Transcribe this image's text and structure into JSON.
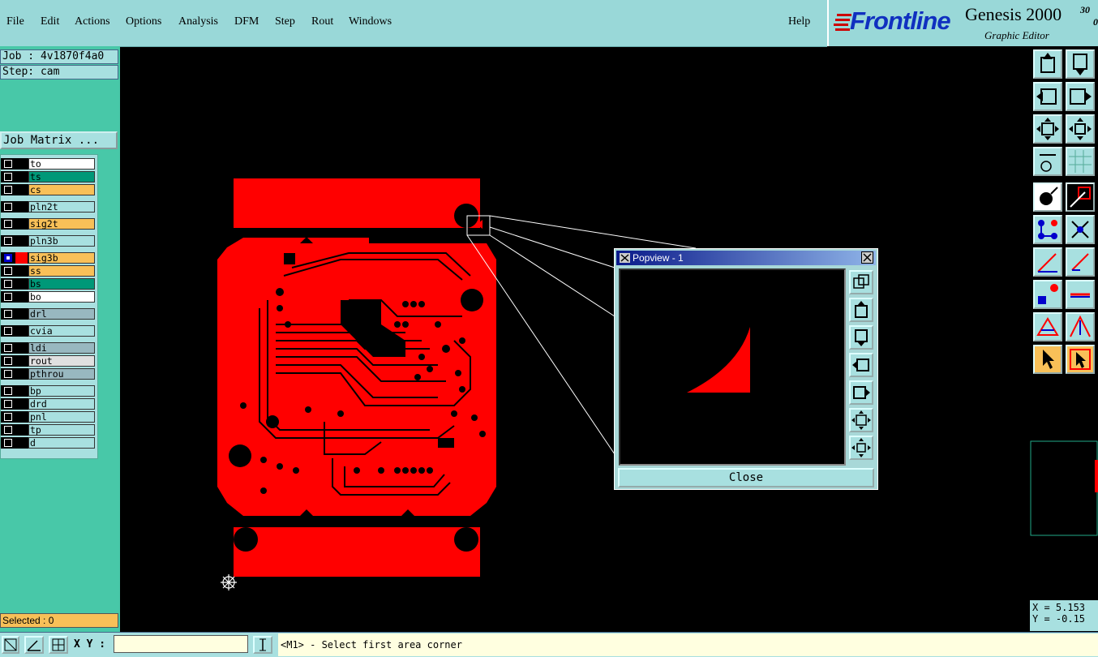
{
  "menu": {
    "items": [
      "File",
      "Edit",
      "Actions",
      "Options",
      "Analysis",
      "DFM",
      "Step",
      "Rout",
      "Windows"
    ],
    "help": "Help"
  },
  "brand": {
    "logo": "Frontline",
    "product": "Genesis 2000",
    "version": "30",
    "version2": "0.",
    "subtitle": "Graphic Editor"
  },
  "job": {
    "job_label": "Job : 4v1870f4a0",
    "step_label": "Step: cam",
    "matrix_button": "Job Matrix ..."
  },
  "layers": [
    {
      "name": "to",
      "color": "#ffffff"
    },
    {
      "name": "ts",
      "color": "#009878"
    },
    {
      "name": "cs",
      "color": "#f8c058"
    },
    {
      "name": "pln2t",
      "color": "#a8e0e0"
    },
    {
      "name": "sig2t",
      "color": "#f8c058"
    },
    {
      "name": "pln3b",
      "color": "#a8e0e0"
    },
    {
      "name": "sig3b",
      "color": "#f8c058",
      "active": true
    },
    {
      "name": "ss",
      "color": "#f8c058"
    },
    {
      "name": "bs",
      "color": "#009878"
    },
    {
      "name": "bo",
      "color": "#ffffff"
    },
    {
      "name": "drl",
      "color": "#98b8c0"
    },
    {
      "name": "cvia",
      "color": "#a8e0e0"
    },
    {
      "name": "ldi",
      "color": "#98b8c0"
    },
    {
      "name": "rout",
      "color": "#e0e0e0"
    },
    {
      "name": "pthrou",
      "color": "#98b8c0"
    },
    {
      "name": "bp",
      "color": "#a8e0e0"
    },
    {
      "name": "drd",
      "color": "#a8e0e0"
    },
    {
      "name": "pnl",
      "color": "#a8e0e0"
    },
    {
      "name": "tp",
      "color": "#a8e0e0"
    },
    {
      "name": "d",
      "color": "#a8e0e0"
    }
  ],
  "status": {
    "selected": "Selected : 0",
    "x": "X = 5.153",
    "y": "Y = -0.15"
  },
  "bottom": {
    "xy_label": "X Y :",
    "xy_value": "",
    "prompt": "<M1> - Select first area corner"
  },
  "popview": {
    "title": "Popview - 1",
    "close": "Close"
  },
  "colors": {
    "board": "#ff0000",
    "panel": "#48c8a8",
    "toolbar_bg": "#a8e0e0"
  }
}
